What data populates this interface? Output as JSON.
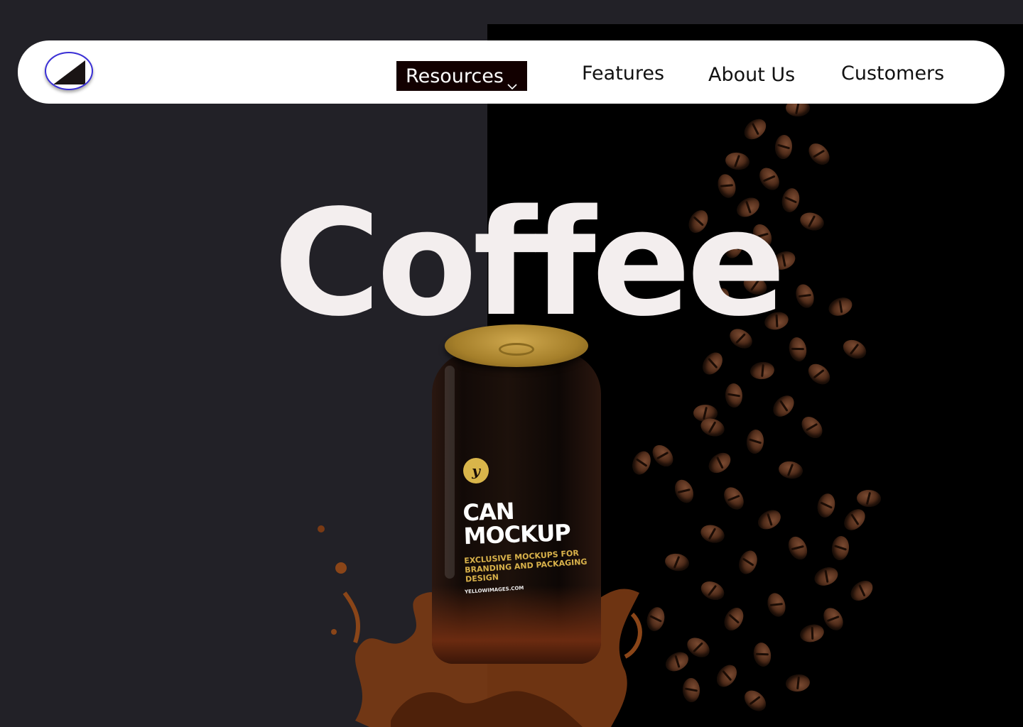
{
  "nav": {
    "logo_icon": "triangle-logo-icon",
    "items": [
      {
        "label": "Resources",
        "has_dropdown": true,
        "active": true
      },
      {
        "label": "Features"
      },
      {
        "label": "About Us"
      },
      {
        "label": "Customers"
      }
    ],
    "dropdown_icon": "chevron-down-icon"
  },
  "hero": {
    "title": "Coffee"
  },
  "product": {
    "badge": "y",
    "title_line1": "CAN",
    "title_line2": "MOCKUP",
    "subtitle": "EXCLUSIVE MOCKUPS FOR BRANDING AND PACKAGING DESIGN",
    "url": "YELLOWIMAGES.COM"
  },
  "colors": {
    "background": "#222127",
    "nav_bg": "#ffffff",
    "active_nav_bg": "#120000",
    "title": "#f3eeee",
    "accent_gold": "#d8b14a"
  }
}
